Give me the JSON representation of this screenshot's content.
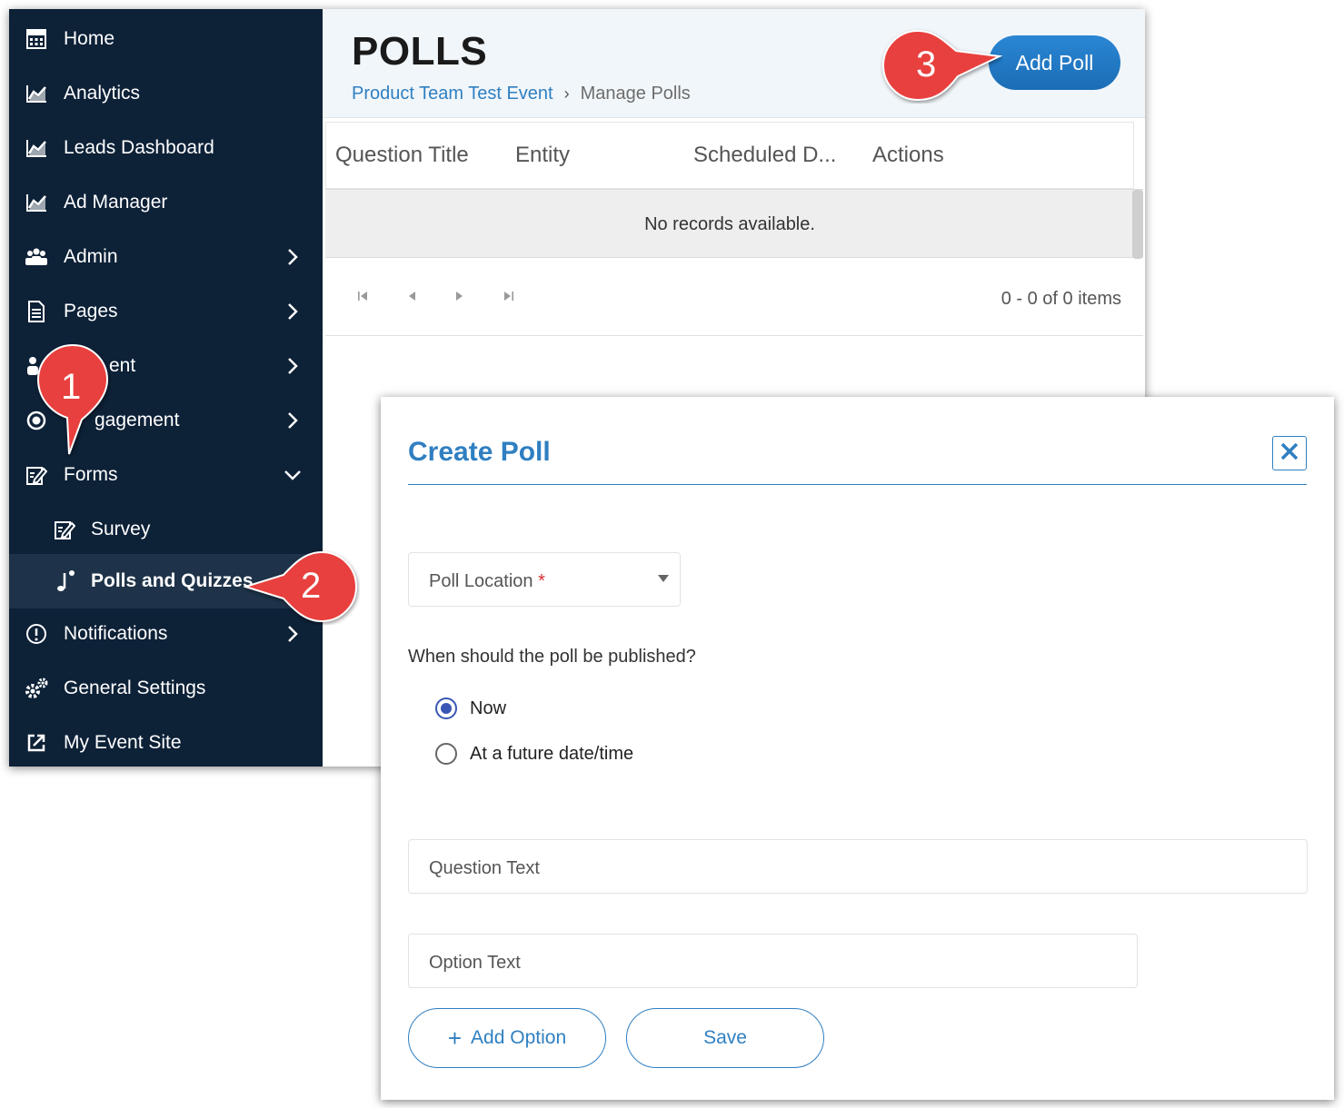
{
  "sidebar": {
    "items": [
      {
        "label": "Home",
        "icon": "calculator-icon"
      },
      {
        "label": "Analytics",
        "icon": "chart-icon"
      },
      {
        "label": "Leads Dashboard",
        "icon": "chart-icon"
      },
      {
        "label": "Ad Manager",
        "icon": "chart-icon"
      },
      {
        "label": "Admin",
        "icon": "users-icon"
      },
      {
        "label": "Pages",
        "icon": "document-icon"
      },
      {
        "label": "ent",
        "icon": "person-icon"
      },
      {
        "label": "gagement",
        "icon": "target-icon"
      },
      {
        "label": "Forms",
        "icon": "edit-form-icon"
      },
      {
        "label": "Survey",
        "icon": "edit-form-icon"
      },
      {
        "label": "Polls and Quizzes",
        "icon": "music-note-icon"
      },
      {
        "label": "Notifications",
        "icon": "alert-circle-icon"
      },
      {
        "label": "General Settings",
        "icon": "gears-icon"
      },
      {
        "label": "My Event Site",
        "icon": "external-link-icon"
      }
    ]
  },
  "header": {
    "title": "POLLS",
    "breadcrumb": {
      "event": "Product Team Test Event",
      "separator": "›",
      "current": "Manage Polls"
    },
    "add_poll_label": "Add Poll"
  },
  "grid": {
    "columns": [
      "Question Title",
      "Entity",
      "Scheduled D...",
      "Actions"
    ],
    "empty_message": "No records available.",
    "pager_info": "0 - 0 of 0 items"
  },
  "callouts": [
    "1",
    "2",
    "3"
  ],
  "dialog": {
    "title": "Create Poll",
    "poll_location_label": "Poll Location",
    "required_mark": "*",
    "publish_question": "When should the poll be published?",
    "publish_options": [
      {
        "label": "Now",
        "checked": true
      },
      {
        "label": "At a future date/time",
        "checked": false
      }
    ],
    "question_text_placeholder": "Question Text",
    "option_text_placeholder": "Option Text",
    "add_option_label": "Add Option",
    "add_option_plus": "+",
    "save_label": "Save"
  },
  "colors": {
    "sidebar_bg": "#0d2137",
    "accent_blue": "#2f7fc1",
    "callout_red": "#e8403e",
    "radio_checked": "#3a56b4"
  }
}
